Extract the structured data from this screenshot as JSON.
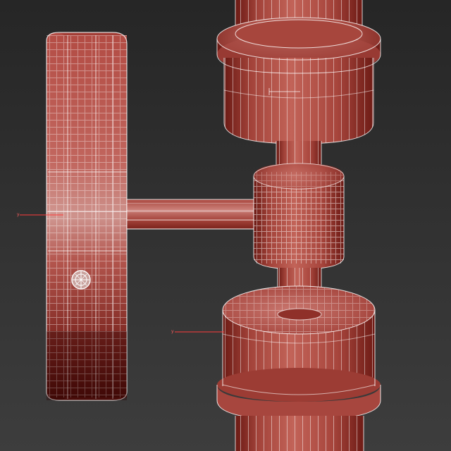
{
  "viewport": {
    "background_top": "#262626",
    "background_bottom": "#3c3c3c",
    "wire_color": "#ffffff"
  },
  "model": {
    "surface_light": "#c46a62",
    "surface_mid": "#a3433a",
    "surface_dark": "#4e0f0b",
    "highlight": "#d69a95"
  },
  "gizmo": {
    "axis_color": "#ff3030"
  }
}
